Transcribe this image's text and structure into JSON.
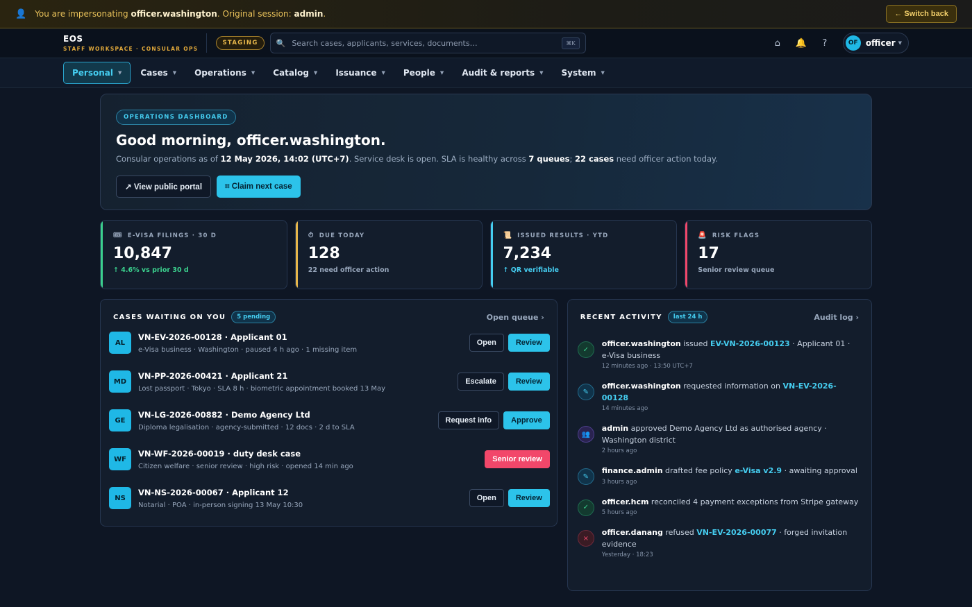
{
  "impersonation": {
    "prefix": "You are impersonating",
    "user": "officer.washington",
    "mid": ". Original session:",
    "original": "admin",
    "suffix": ".",
    "switch_back": "← Switch back"
  },
  "header": {
    "brand": "EOS",
    "brand_sub": "STAFF WORKSPACE · CONSULAR OPS",
    "env": "STAGING",
    "search_placeholder": "Search cases, applicants, services, documents…",
    "search_kbd": "⌘K",
    "user_initials": "OF",
    "user_name": "officer"
  },
  "nav": [
    "Personal",
    "Cases",
    "Operations",
    "Catalog",
    "Issuance",
    "People",
    "Audit & reports",
    "System"
  ],
  "hero": {
    "badge": "OPERATIONS DASHBOARD",
    "greeting": "Good morning, officer.washington.",
    "sub_1": "Consular operations as of ",
    "sub_date": "12 May 2026, 14:02 (UTC+7)",
    "sub_2": ". Service desk is open. SLA is healthy across ",
    "sub_queues": "7 queues",
    "sub_3": "; ",
    "sub_cases": "22 cases",
    "sub_4": " need officer action today.",
    "btn_portal": "↗ View public portal",
    "btn_claim": "⌗ Claim next case"
  },
  "kpis": [
    {
      "icon": "🎟",
      "label": "E-VISA FILINGS · 30 D",
      "value": "10,847",
      "foot": "↑ 4.6% vs prior 30 d",
      "accent": "#3bd08e",
      "foot_color": "#3bd08e"
    },
    {
      "icon": "⏱",
      "label": "DUE TODAY",
      "value": "128",
      "foot": "22 need officer action",
      "accent": "#e6b64a",
      "foot_color": "#98a7bc"
    },
    {
      "icon": "📜",
      "label": "ISSUED RESULTS · YTD",
      "value": "7,234",
      "foot": "↑ QR verifiable",
      "accent": "#45cdf0",
      "foot_color": "#45cdf0"
    },
    {
      "icon": "🚨",
      "label": "RISK FLAGS",
      "value": "17",
      "foot": "Senior review queue",
      "accent": "#f2476a",
      "foot_color": "#98a7bc"
    }
  ],
  "cases": {
    "title": "CASES WAITING ON YOU",
    "badge": "5 pending",
    "link": "Open queue ›",
    "rows": [
      {
        "initials": "AL",
        "title": "VN-EV-2026-00128 · Applicant 01",
        "meta": "e-Visa business · Washington · paused 4 h ago · 1 missing item",
        "secondary": "Open",
        "primary": "Review",
        "primary_kind": "cyan"
      },
      {
        "initials": "MD",
        "title": "VN-PP-2026-00421 · Applicant 21",
        "meta": "Lost passport · Tokyo · SLA 8 h · biometric appointment booked 13 May",
        "secondary": "Escalate",
        "primary": "Review",
        "primary_kind": "cyan"
      },
      {
        "initials": "GE",
        "title": "VN-LG-2026-00882 · Demo Agency Ltd",
        "meta": "Diploma legalisation · agency-submitted · 12 docs · 2 d to SLA",
        "secondary": "Request info",
        "primary": "Approve",
        "primary_kind": "cyan"
      },
      {
        "initials": "WF",
        "title": "VN-WF-2026-00019 · duty desk case",
        "meta": "Citizen welfare · senior review · high risk · opened 14 min ago",
        "secondary": "",
        "primary": "Senior review",
        "primary_kind": "red"
      },
      {
        "initials": "NS",
        "title": "VN-NS-2026-00067 · Applicant 12",
        "meta": "Notarial · POA · in-person signing 13 May 10:30",
        "secondary": "Open",
        "primary": "Review",
        "primary_kind": "cyan"
      }
    ]
  },
  "activity": {
    "title": "RECENT ACTIVITY",
    "badge": "last 24 h",
    "link": "Audit log ›",
    "items": [
      {
        "kind": "green",
        "icon": "✓",
        "actor": "officer.washington",
        "verb": " issued ",
        "ref": "EV-VN-2026-00123",
        "rest": " · Applicant 01 · e-Visa business",
        "time": "12 minutes ago · 13:50 UTC+7"
      },
      {
        "kind": "cyan",
        "icon": "✎",
        "actor": "officer.washington",
        "verb": " requested information on ",
        "ref": "VN-EV-2026-00128",
        "rest": "",
        "time": "14 minutes ago"
      },
      {
        "kind": "purple",
        "icon": "👥",
        "actor": "admin",
        "verb": " approved Demo Agency Ltd as authorised agency · Washington district",
        "ref": "",
        "rest": "",
        "time": "2 hours ago"
      },
      {
        "kind": "cyan",
        "icon": "✎",
        "actor": "finance.admin",
        "verb": " drafted fee policy ",
        "ref": "e-Visa v2.9",
        "rest": " · awaiting approval",
        "time": "3 hours ago"
      },
      {
        "kind": "green",
        "icon": "✓",
        "actor": "officer.hcm",
        "verb": " reconciled 4 payment exceptions from Stripe gateway",
        "ref": "",
        "rest": "",
        "time": "5 hours ago"
      },
      {
        "kind": "red",
        "icon": "×",
        "actor": "officer.danang",
        "verb": " refused ",
        "ref": "VN-EV-2026-00077",
        "rest": " · forged invitation evidence",
        "time": "Yesterday · 18:23"
      }
    ]
  }
}
